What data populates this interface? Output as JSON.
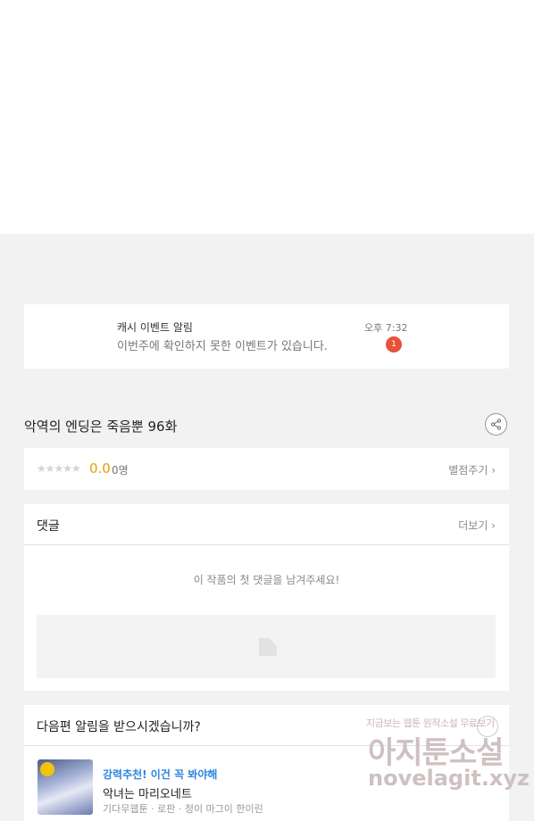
{
  "notification": {
    "title": "캐시 이벤트 알림",
    "message": "이번주에 확인하지 못한 이벤트가 있습니다.",
    "time": "오후 7:32",
    "badge_count": "1"
  },
  "episode": {
    "title": "악역의 엔딩은 죽음뿐 96화",
    "share_icon": "share-icon"
  },
  "rating": {
    "stars": "★★★★★",
    "score": "0.0",
    "count": "0명",
    "rate_link": "별점주기 ›",
    "star_color": "#d3d3d3",
    "score_color": "#e89f00"
  },
  "comments": {
    "title": "댓글",
    "more": "더보기 ›",
    "empty_message": "이 작품의 첫 댓글을 남겨주세요!"
  },
  "next_alert": {
    "title": "다음편 알림을 받으시겠습니까?",
    "recommendation": {
      "tag": "강력추천! 이건 꼭 봐야해",
      "title": "악녀는 마리오네트",
      "subtitle": "기다무웹툰 · 로판 · 정이 마그이 한이린",
      "tag_color": "#2e86de"
    }
  },
  "watermark": {
    "line1": "지금보는 웹툰 원작소설 무료보기",
    "line2": "아지툰소설",
    "line3": "novelagit.xyz"
  },
  "colors": {
    "background": "#f2f2f2",
    "badge": "#e8523a"
  }
}
